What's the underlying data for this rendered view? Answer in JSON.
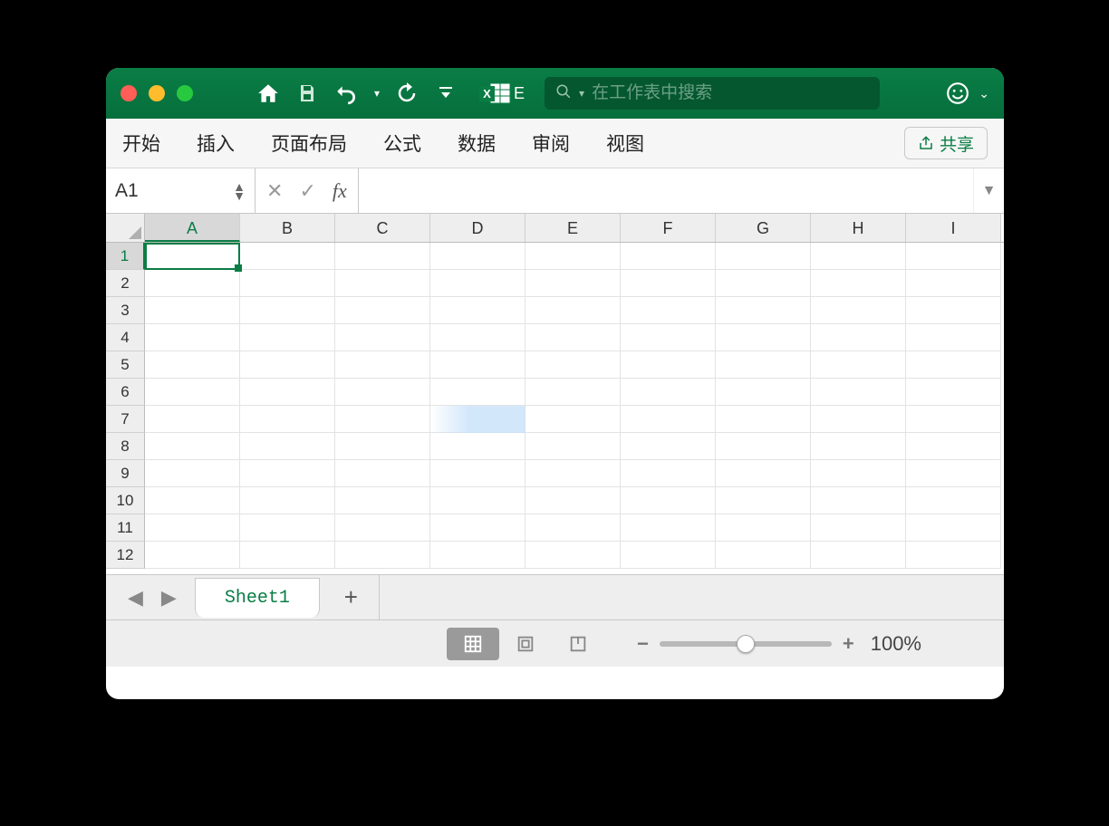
{
  "titlebar": {
    "search_placeholder": "在工作表中搜索"
  },
  "ribbon": {
    "tabs": [
      "开始",
      "插入",
      "页面布局",
      "公式",
      "数据",
      "审阅",
      "视图"
    ],
    "share_label": "共享"
  },
  "formula": {
    "namebox": "A1",
    "fx_label": "fx",
    "value": ""
  },
  "grid": {
    "columns": [
      "A",
      "B",
      "C",
      "D",
      "E",
      "F",
      "G",
      "H",
      "I"
    ],
    "rows": [
      "1",
      "2",
      "3",
      "4",
      "5",
      "6",
      "7",
      "8",
      "9",
      "10",
      "11",
      "12"
    ],
    "active_col": "A",
    "active_row": "1"
  },
  "sheets": {
    "active": "Sheet1"
  },
  "status": {
    "zoom": "100%"
  }
}
